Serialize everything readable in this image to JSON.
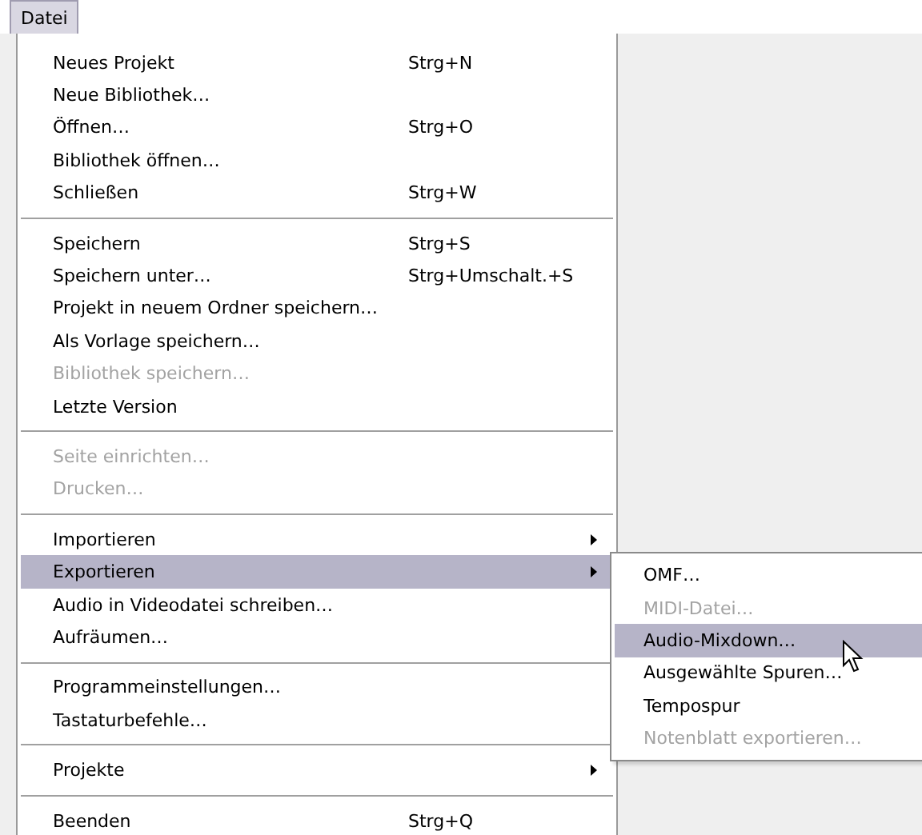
{
  "menubar": [
    {
      "label": "Datei",
      "selected": true
    }
  ],
  "menu": {
    "groups": [
      [
        {
          "label": "Neues Projekt",
          "shortcut": "Strg+N",
          "disabled": false,
          "selected": false,
          "has_submenu": false
        },
        {
          "label": "Neue Bibliothek…",
          "disabled": false,
          "selected": false,
          "has_submenu": false
        },
        {
          "label": "Öffnen…",
          "shortcut": "Strg+O",
          "disabled": false,
          "selected": false,
          "has_submenu": false
        },
        {
          "label": "Bibliothek öffnen…",
          "disabled": false,
          "selected": false,
          "has_submenu": false
        },
        {
          "label": "Schließen",
          "shortcut": "Strg+W",
          "disabled": false,
          "selected": false,
          "has_submenu": false
        }
      ],
      [
        {
          "label": "Speichern",
          "shortcut": "Strg+S",
          "disabled": false,
          "selected": false,
          "has_submenu": false
        },
        {
          "label": "Speichern unter…",
          "shortcut": "Strg+Umschalt.+S",
          "disabled": false,
          "selected": false,
          "has_submenu": false
        },
        {
          "label": "Projekt in neuem Ordner speichern…",
          "disabled": false,
          "selected": false,
          "has_submenu": false
        },
        {
          "label": "Als Vorlage speichern…",
          "disabled": false,
          "selected": false,
          "has_submenu": false
        },
        {
          "label": "Bibliothek speichern…",
          "disabled": true,
          "selected": false,
          "has_submenu": false
        },
        {
          "label": "Letzte Version",
          "disabled": false,
          "selected": false,
          "has_submenu": false
        }
      ],
      [
        {
          "label": "Seite einrichten…",
          "disabled": true,
          "selected": false,
          "has_submenu": false
        },
        {
          "label": "Drucken…",
          "disabled": true,
          "selected": false,
          "has_submenu": false
        }
      ],
      [
        {
          "label": "Importieren",
          "disabled": false,
          "selected": false,
          "has_submenu": true
        },
        {
          "label": "Exportieren",
          "disabled": false,
          "selected": true,
          "has_submenu": true,
          "submenu": [
            {
              "label": "OMF…",
              "disabled": false,
              "selected": false
            },
            {
              "label": "MIDI-Datei…",
              "disabled": true,
              "selected": false
            },
            {
              "label": "Audio-Mixdown…",
              "disabled": false,
              "selected": true
            },
            {
              "label": "Ausgewählte Spuren…",
              "disabled": false,
              "selected": false
            },
            {
              "label": "Tempospur",
              "disabled": false,
              "selected": false
            },
            {
              "label": "Notenblatt exportieren…",
              "disabled": true,
              "selected": false
            }
          ]
        },
        {
          "label": "Audio in Videodatei schreiben…",
          "disabled": false,
          "selected": false,
          "has_submenu": false
        },
        {
          "label": "Aufräumen…",
          "disabled": false,
          "selected": false,
          "has_submenu": false
        }
      ],
      [
        {
          "label": "Programmeinstellungen…",
          "disabled": false,
          "selected": false,
          "has_submenu": false
        },
        {
          "label": "Tastaturbefehle…",
          "disabled": false,
          "selected": false,
          "has_submenu": false
        }
      ],
      [
        {
          "label": "Projekte",
          "disabled": false,
          "selected": false,
          "has_submenu": true
        }
      ],
      [
        {
          "label": "Beenden",
          "shortcut": "Strg+Q",
          "disabled": false,
          "selected": false,
          "has_submenu": false
        }
      ]
    ]
  }
}
